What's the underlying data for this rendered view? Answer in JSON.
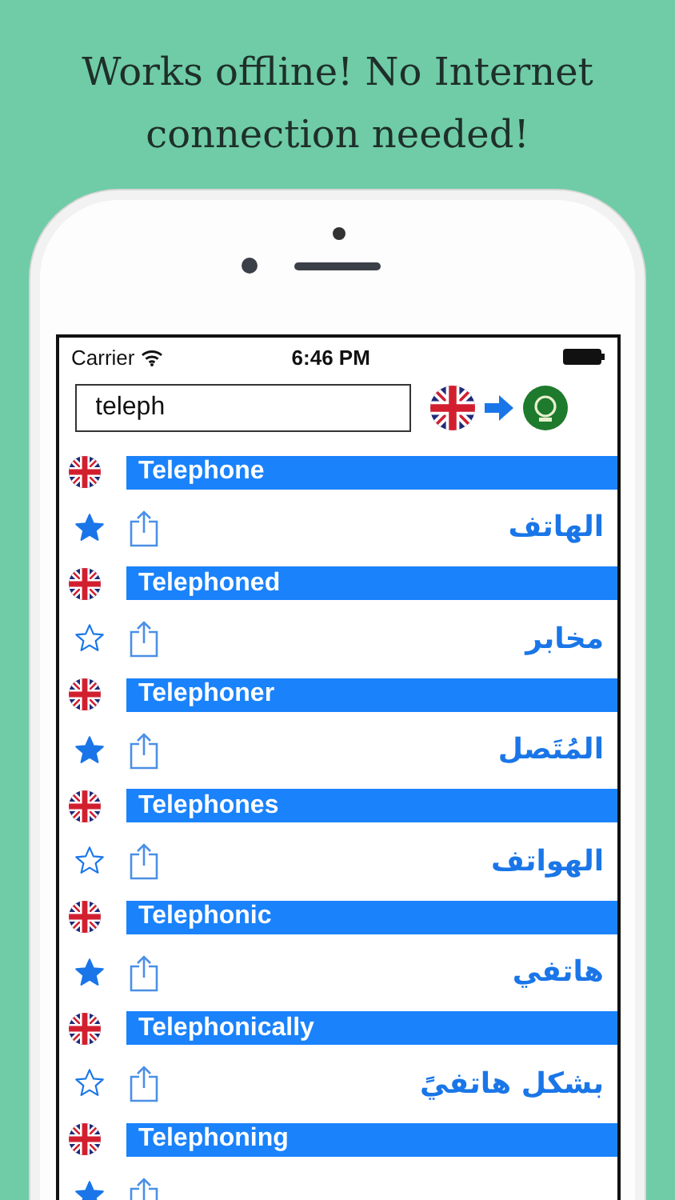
{
  "headline": "Works offline! No Internet connection needed!",
  "status_bar": {
    "carrier": "Carrier",
    "time": "6:46 PM"
  },
  "search": {
    "value": "teleph"
  },
  "entries": [
    {
      "word": "Telephone",
      "translation": "الهاتف",
      "starred": true
    },
    {
      "word": "Telephoned",
      "translation": "مخابر",
      "starred": false
    },
    {
      "word": "Telephoner",
      "translation": "المُتَصل",
      "starred": true
    },
    {
      "word": "Telephones",
      "translation": "الهواتف",
      "starred": false
    },
    {
      "word": "Telephonic",
      "translation": "هاتفي",
      "starred": true
    },
    {
      "word": "Telephonically",
      "translation": "بشكل هاتفيً",
      "starred": false
    },
    {
      "word": "Telephoning",
      "starred": true
    }
  ]
}
